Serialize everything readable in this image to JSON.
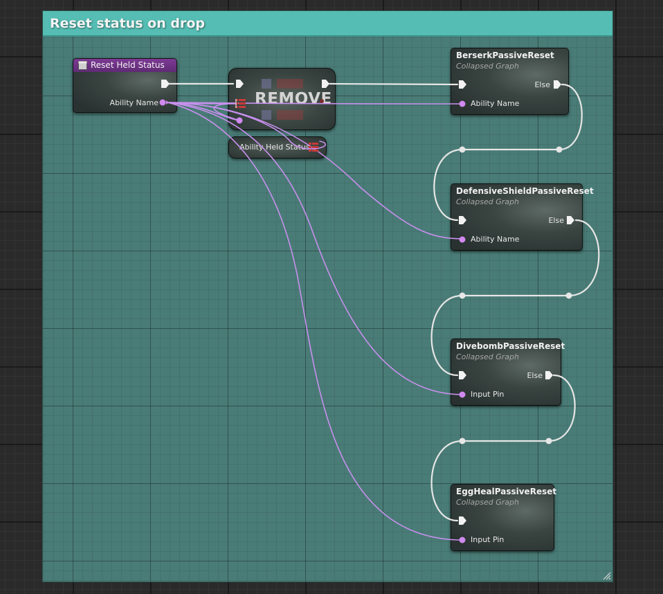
{
  "comment": {
    "title": "Reset status on drop"
  },
  "nodes": {
    "event": {
      "title": "Reset Held Status",
      "output_pin": "Ability Name",
      "header_color": "#6a2f80"
    },
    "remove": {
      "title": "REMOVE"
    },
    "variable": {
      "title": "Ability Held Status"
    },
    "berserk": {
      "title": "BerserkPassiveReset",
      "subtitle": "Collapsed Graph",
      "input_pin": "Ability Name",
      "else_label": "Else"
    },
    "defensive": {
      "title": "DefensiveShieldPassiveReset",
      "subtitle": "Collapsed Graph",
      "input_pin": "Ability Name",
      "else_label": "Else"
    },
    "divebomb": {
      "title": "DivebombPassiveReset",
      "subtitle": "Collapsed Graph",
      "input_pin": "Input Pin",
      "else_label": "Else"
    },
    "egg": {
      "title": "EggHealPassiveReset",
      "subtitle": "Collapsed Graph",
      "input_pin": "Input Pin"
    }
  },
  "colors": {
    "exec_wire": "#e6e6e6",
    "name_wire": "#c888ea",
    "comment_bg": "#4a7c77",
    "comment_header": "#55bdb3"
  }
}
